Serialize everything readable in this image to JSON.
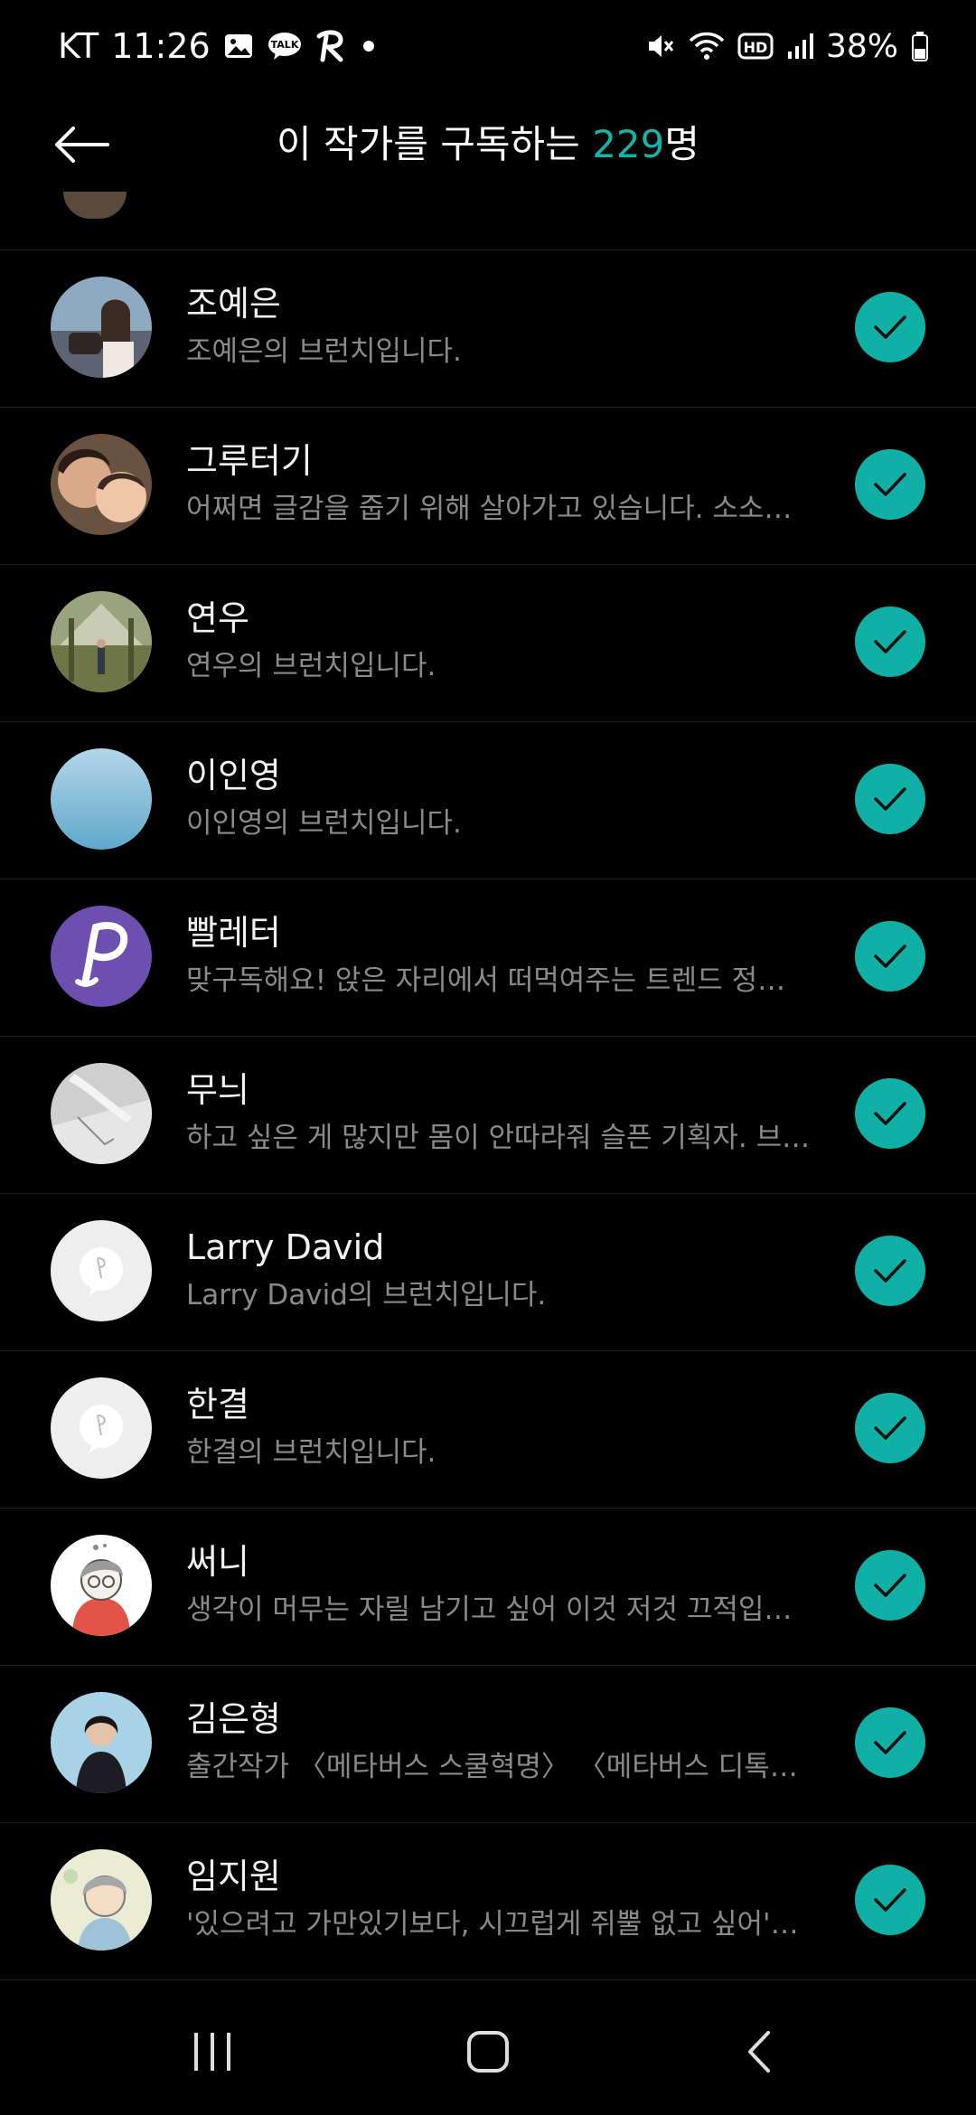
{
  "status_bar": {
    "carrier": "KT",
    "time": "11:26",
    "battery": "38%",
    "notification_icons": [
      "gallery-icon",
      "kakaotalk-icon",
      "r-app-icon",
      "dot-icon"
    ],
    "system_icons": [
      "mute-icon",
      "wifi-icon",
      "hd-icon",
      "signal-icon",
      "battery-icon"
    ]
  },
  "header": {
    "title_prefix": "이 작가를 구독하는 ",
    "count": "229",
    "title_suffix": "명"
  },
  "subscribers": [
    {
      "name": "조예은",
      "desc": "조예은의 브런치입니다."
    },
    {
      "name": "그루터기",
      "desc": "어쩌면 글감을 줍기 위해 살아가고 있습니다.  소소…"
    },
    {
      "name": "연우",
      "desc": "연우의 브런치입니다."
    },
    {
      "name": "이인영",
      "desc": "이인영의 브런치입니다."
    },
    {
      "name": "빨레터",
      "desc": "맞구독해요! 앉은 자리에서 떠먹여주는 트렌드 정…"
    },
    {
      "name": "무늬",
      "desc": "하고 싶은 게 많지만 몸이 안따라줘 슬픈 기획자. 브…"
    },
    {
      "name": "Larry David",
      "desc": "Larry David의 브런치입니다."
    },
    {
      "name": "한결",
      "desc": "한결의 브런치입니다."
    },
    {
      "name": "써니",
      "desc": "생각이 머무는 자릴 남기고 싶어 이것 저것 끄적입…"
    },
    {
      "name": "김은형",
      "desc": "출간작가 〈메타버스 스쿨혁명〉 〈메타버스 디톡스쿨…"
    },
    {
      "name": "임지원",
      "desc": "'있으려고 가만있기보다, 시끄럽게 쥐뿔 없고 싶어'…"
    }
  ],
  "colors": {
    "accent": "#10b0a6",
    "background": "#000000",
    "divider": "#1e1e1e"
  },
  "nav": [
    "recent-apps-icon",
    "home-icon",
    "back-nav-icon"
  ]
}
